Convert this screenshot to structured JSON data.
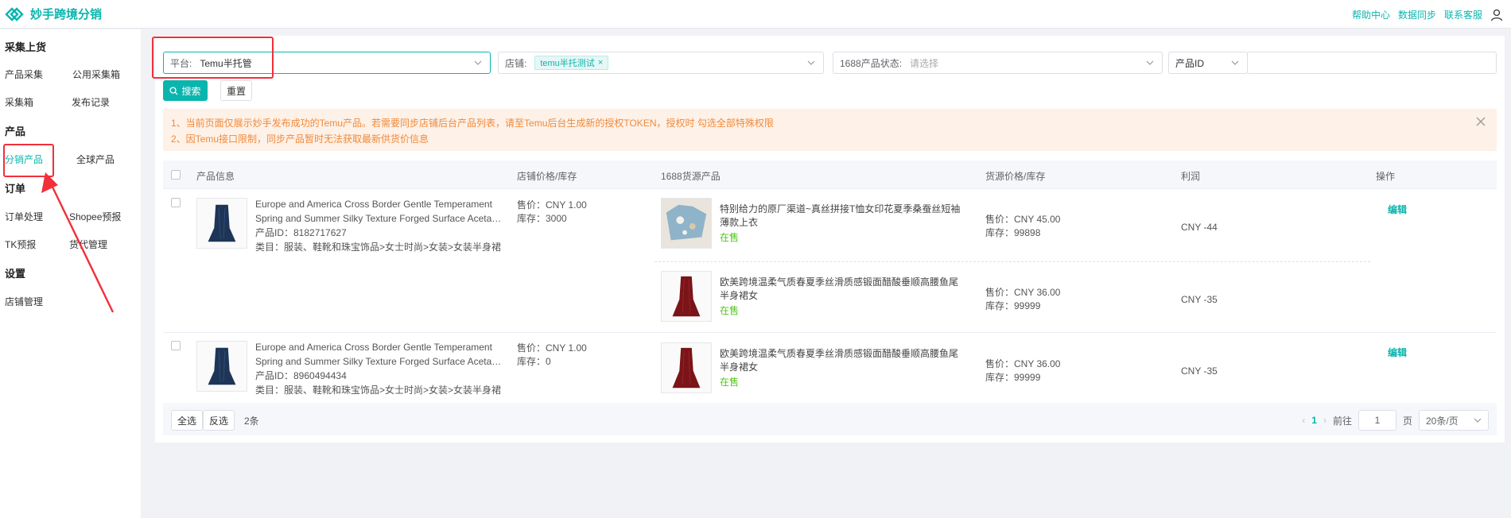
{
  "app": {
    "title": "妙手跨境分销"
  },
  "header": {
    "links": [
      "帮助中心",
      "数据同步",
      "联系客服"
    ]
  },
  "sidebar": {
    "groups": [
      {
        "title": "采集上货",
        "items": [
          "产品采集",
          "公用采集箱",
          "采集箱",
          "发布记录"
        ]
      },
      {
        "title": "产品",
        "items": [
          "分销产品",
          "全球产品"
        ]
      },
      {
        "title": "订单",
        "items": [
          "订单处理",
          "Shopee预报",
          "TK预报",
          "货代管理"
        ]
      },
      {
        "title": "设置",
        "items": [
          "店铺管理"
        ]
      }
    ],
    "active_item": "分销产品"
  },
  "filters": {
    "platform_label": "平台:",
    "platform_value": "Temu半托管",
    "shop_label": "店铺:",
    "shop_tag": "temu半托测试",
    "status_label": "1688产品状态:",
    "status_placeholder": "请选择",
    "id_select": "产品ID",
    "id_input_value": ""
  },
  "buttons": {
    "search": "搜索",
    "reset": "重置"
  },
  "alert": {
    "line1": "1、当前页面仅展示妙手发布成功的Temu产品。若需要同步店铺后台产品列表，请至Temu后台生成新的授权TOKEN，授权时 勾选全部特殊权限",
    "line2": "2、因Temu接口限制，同步产品暂时无法获取最新供货价信息"
  },
  "table": {
    "headers": [
      "产品信息",
      "店铺价格/库存",
      "1688货源产品",
      "货源价格/库存",
      "利润",
      "操作"
    ],
    "rows": [
      {
        "title_l1": "Europe and America Cross Border Gentle Temperament",
        "title_l2": "Spring and Summer Silky Texture Forged Surface Acetate Drape High Waist Fishtail Skirt",
        "product_id": "产品ID：8182717627",
        "category": "类目：服装、鞋靴和珠宝饰品>女士时尚>女装>女装半身裙",
        "price": "售价：CNY 1.00",
        "stock": "库存：3000",
        "edit": "编辑",
        "sources": [
          {
            "title": "特别给力的原厂渠道~真丝拼接T恤女印花夏季桑蚕丝短袖薄款上衣",
            "status": "在售",
            "price": "售价：CNY 45.00",
            "stock": "库存：99898",
            "profit": "CNY -44"
          },
          {
            "title": "欧美跨境温柔气质春夏季丝滑质感锻面醋酸垂顺高腰鱼尾半身裙女",
            "status": "在售",
            "price": "售价：CNY 36.00",
            "stock": "库存：99999",
            "profit": "CNY -35"
          }
        ]
      },
      {
        "title_l1": "Europe and America Cross Border Gentle Temperament",
        "title_l2": "Spring and Summer Silky Texture Forged Surface Acetate Drape High Waist Fishtail Skirt",
        "product_id": "产品ID：8960494434",
        "category": "类目：服装、鞋靴和珠宝饰品>女士时尚>女装>女装半身裙",
        "price": "售价：CNY 1.00",
        "stock": "库存：0",
        "edit": "编辑",
        "sources": [
          {
            "title": "欧美跨境温柔气质春夏季丝滑质感锻面醋酸垂顺高腰鱼尾半身裙女",
            "status": "在售",
            "price": "售价：CNY 36.00",
            "stock": "库存：99999",
            "profit": "CNY -35"
          }
        ]
      }
    ]
  },
  "footer": {
    "select_all": "全选",
    "invert": "反选",
    "count": "2条",
    "current_page": "1",
    "goto_label": "前往",
    "goto_value": "1",
    "page_unit": "页",
    "page_size": "20条/页"
  },
  "colors": {
    "accent": "#0ab5ae",
    "warn": "#f08a3a",
    "highlight": "#f0303a",
    "onsale": "#52c41a"
  }
}
